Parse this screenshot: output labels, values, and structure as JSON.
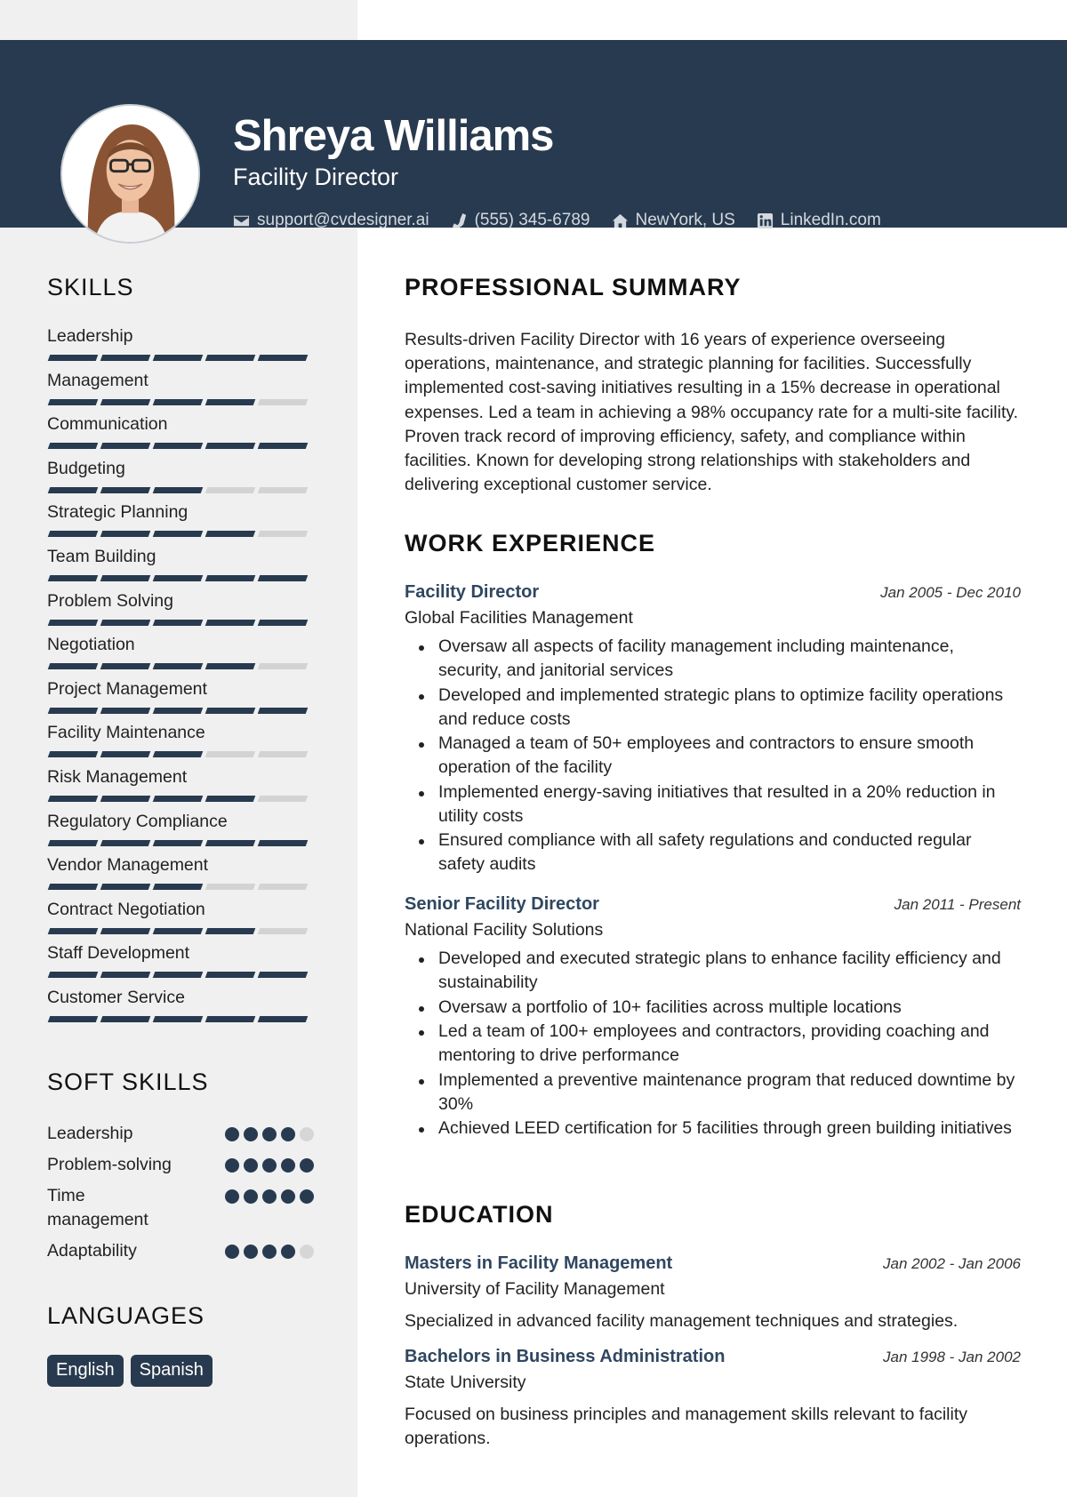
{
  "header": {
    "name": "Shreya Williams",
    "title": "Facility Director",
    "contacts": [
      {
        "icon": "envelope-icon",
        "text": "support@cvdesigner.ai"
      },
      {
        "icon": "phone-icon",
        "text": "(555) 345-6789"
      },
      {
        "icon": "home-icon",
        "text": "NewYork, US"
      },
      {
        "icon": "linkedin-icon",
        "text": "LinkedIn.com"
      }
    ]
  },
  "colors": {
    "primary": "#283a4f",
    "sidebar": "#f0f0f0",
    "inactive": "#d3d3d3",
    "accent_text": "#2f4760"
  },
  "sidebar": {
    "skills_heading": "SKILLS",
    "skills": [
      {
        "label": "Leadership",
        "level": 5,
        "max": 5
      },
      {
        "label": "Management",
        "level": 4,
        "max": 5
      },
      {
        "label": "Communication",
        "level": 5,
        "max": 5
      },
      {
        "label": "Budgeting",
        "level": 3,
        "max": 5
      },
      {
        "label": "Strategic Planning",
        "level": 4,
        "max": 5
      },
      {
        "label": "Team Building",
        "level": 5,
        "max": 5
      },
      {
        "label": "Problem Solving",
        "level": 5,
        "max": 5
      },
      {
        "label": "Negotiation",
        "level": 4,
        "max": 5
      },
      {
        "label": "Project Management",
        "level": 5,
        "max": 5
      },
      {
        "label": "Facility Maintenance",
        "level": 3,
        "max": 5
      },
      {
        "label": "Risk Management",
        "level": 4,
        "max": 5
      },
      {
        "label": "Regulatory Compliance",
        "level": 5,
        "max": 5
      },
      {
        "label": "Vendor Management",
        "level": 3,
        "max": 5
      },
      {
        "label": "Contract Negotiation",
        "level": 4,
        "max": 5
      },
      {
        "label": "Staff Development",
        "level": 5,
        "max": 5
      },
      {
        "label": "Customer Service",
        "level": 5,
        "max": 5
      }
    ],
    "soft_skills_heading": "SOFT SKILLS",
    "soft_skills": [
      {
        "label": "Leadership",
        "level": 4,
        "max": 5
      },
      {
        "label": "Problem-solving",
        "level": 5,
        "max": 5
      },
      {
        "label": "Time management",
        "level": 5,
        "max": 5
      },
      {
        "label": "Adaptability",
        "level": 4,
        "max": 5
      }
    ],
    "languages_heading": "LANGUAGES",
    "languages": [
      "English",
      "Spanish"
    ]
  },
  "main": {
    "summary_heading": "PROFESSIONAL SUMMARY",
    "summary": "Results-driven Facility Director with 16 years of experience overseeing operations, maintenance, and strategic planning for facilities. Successfully implemented cost-saving initiatives resulting in a 15% decrease in operational expenses. Led a team in achieving a 98% occupancy rate for a multi-site facility. Proven track record of improving efficiency, safety, and compliance within facilities. Known for developing strong relationships with stakeholders and delivering exceptional customer service.",
    "experience_heading": "WORK EXPERIENCE",
    "experience": [
      {
        "role": "Facility Director",
        "dates": "Jan 2005 - Dec 2010",
        "company": "Global Facilities Management",
        "bullets": [
          "Oversaw all aspects of facility management including maintenance, security, and janitorial services",
          "Developed and implemented strategic plans to optimize facility operations and reduce costs",
          "Managed a team of 50+ employees and contractors to ensure smooth operation of the facility",
          "Implemented energy-saving initiatives that resulted in a 20% reduction in utility costs",
          "Ensured compliance with all safety regulations and conducted regular safety audits"
        ]
      },
      {
        "role": "Senior Facility Director",
        "dates": "Jan 2011 - Present",
        "company": "National Facility Solutions",
        "bullets": [
          "Developed and executed strategic plans to enhance facility efficiency and sustainability",
          "Oversaw a portfolio of 10+ facilities across multiple locations",
          "Led a team of 100+ employees and contractors, providing coaching and mentoring to drive performance",
          "Implemented a preventive maintenance program that reduced downtime by 30%",
          "Achieved LEED certification for 5 facilities through green building initiatives"
        ]
      }
    ],
    "education_heading": "EDUCATION",
    "education": [
      {
        "degree": "Masters in Facility Management",
        "dates": "Jan 2002 - Jan 2006",
        "school": "University of Facility Management",
        "description": "Specialized in advanced facility management techniques and strategies."
      },
      {
        "degree": "Bachelors in Business Administration",
        "dates": "Jan 1998 - Jan 2002",
        "school": "State University",
        "description": "Focused on business principles and management skills relevant to facility operations."
      }
    ]
  }
}
